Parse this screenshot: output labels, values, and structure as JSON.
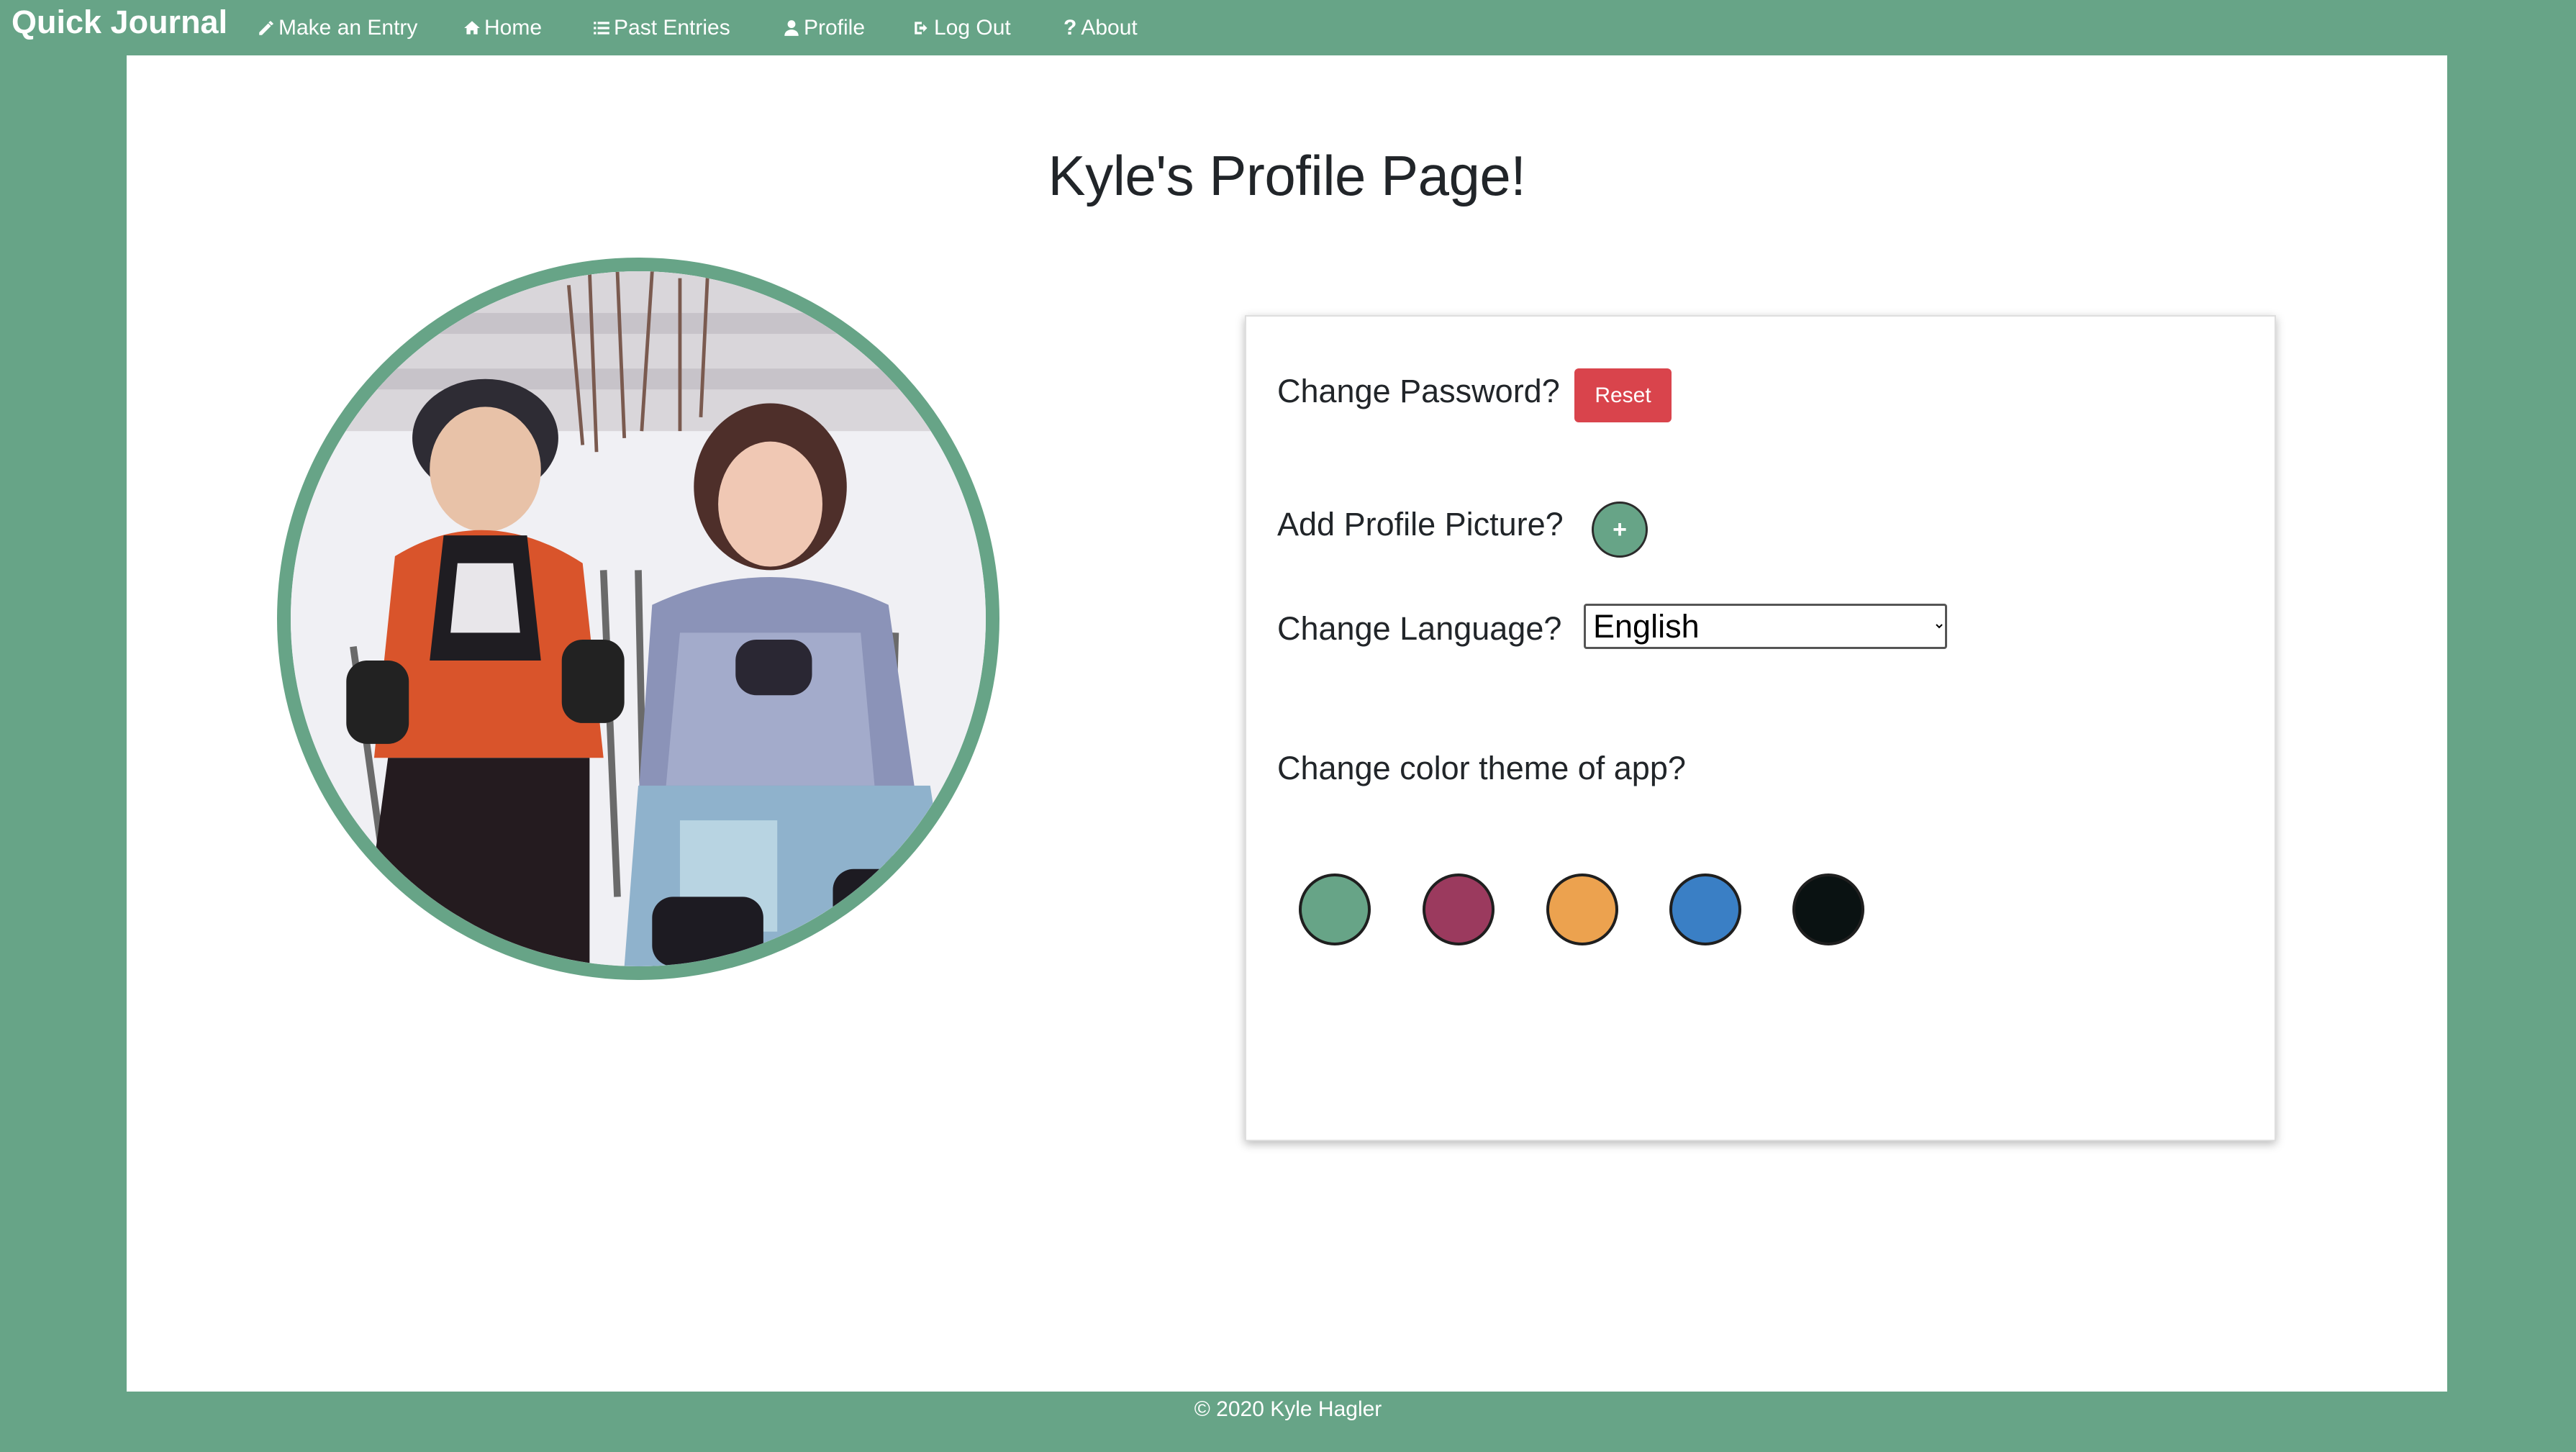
{
  "nav": {
    "brand": "Quick Journal",
    "items": [
      {
        "label": "Make an Entry",
        "icon": "pencil-icon"
      },
      {
        "label": "Home",
        "icon": "home-icon"
      },
      {
        "label": "Past Entries",
        "icon": "list-icon"
      },
      {
        "label": "Profile",
        "icon": "user-icon"
      },
      {
        "label": "Log Out",
        "icon": "sign-out-icon"
      },
      {
        "label": "About",
        "icon": "question-icon"
      }
    ]
  },
  "page": {
    "title": "Kyle's Profile Page!"
  },
  "profile_picture": {
    "description_icon": "profile-photo"
  },
  "settings": {
    "password_label": "Change Password?",
    "reset_label": "Reset",
    "picture_label": "Add Profile Picture?",
    "add_label": "+",
    "language_label": "Change Language?",
    "language_selected": "English",
    "theme_label": "Change color theme of app?",
    "themes": [
      {
        "name": "green",
        "color": "#67a487"
      },
      {
        "name": "maroon",
        "color": "#9b3a5e"
      },
      {
        "name": "orange",
        "color": "#eca24f"
      },
      {
        "name": "blue",
        "color": "#3a7fc5"
      },
      {
        "name": "black",
        "color": "#0a1212"
      }
    ]
  },
  "colors": {
    "theme": "#67a487",
    "reset": "#d9444c"
  },
  "footer": {
    "text": "© 2020 Kyle Hagler"
  }
}
